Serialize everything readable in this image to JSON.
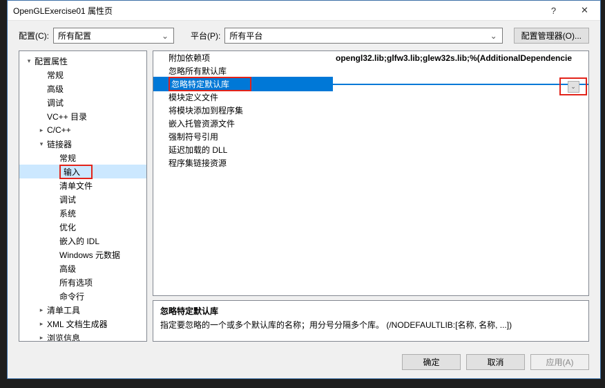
{
  "title": "OpenGLExercise01 属性页",
  "topbar": {
    "config_label": "配置(C):",
    "config_value": "所有配置",
    "platform_label": "平台(P):",
    "platform_value": "所有平台",
    "manager_btn": "配置管理器(O)..."
  },
  "tree": [
    {
      "label": "配置属性",
      "depth": 0,
      "arrow": "▾"
    },
    {
      "label": "常规",
      "depth": 1,
      "arrow": ""
    },
    {
      "label": "高级",
      "depth": 1,
      "arrow": ""
    },
    {
      "label": "调试",
      "depth": 1,
      "arrow": ""
    },
    {
      "label": "VC++ 目录",
      "depth": 1,
      "arrow": ""
    },
    {
      "label": "C/C++",
      "depth": 1,
      "arrow": "▸"
    },
    {
      "label": "链接器",
      "depth": 1,
      "arrow": "▾"
    },
    {
      "label": "常规",
      "depth": 2,
      "arrow": ""
    },
    {
      "label": "输入",
      "depth": 2,
      "arrow": "",
      "selected": true,
      "highlight": true
    },
    {
      "label": "清单文件",
      "depth": 2,
      "arrow": ""
    },
    {
      "label": "调试",
      "depth": 2,
      "arrow": ""
    },
    {
      "label": "系统",
      "depth": 2,
      "arrow": ""
    },
    {
      "label": "优化",
      "depth": 2,
      "arrow": ""
    },
    {
      "label": "嵌入的 IDL",
      "depth": 2,
      "arrow": ""
    },
    {
      "label": "Windows 元数据",
      "depth": 2,
      "arrow": ""
    },
    {
      "label": "高级",
      "depth": 2,
      "arrow": ""
    },
    {
      "label": "所有选项",
      "depth": 2,
      "arrow": ""
    },
    {
      "label": "命令行",
      "depth": 2,
      "arrow": ""
    },
    {
      "label": "清单工具",
      "depth": 1,
      "arrow": "▸"
    },
    {
      "label": "XML 文档生成器",
      "depth": 1,
      "arrow": "▸"
    },
    {
      "label": "浏览信息",
      "depth": 1,
      "arrow": "▸"
    }
  ],
  "props": [
    {
      "name": "附加依赖项",
      "value": "opengl32.lib;glfw3.lib;glew32s.lib;%(AdditionalDependencie",
      "bold_value": true
    },
    {
      "name": "忽略所有默认库",
      "value": ""
    },
    {
      "name": "忽略特定默认库",
      "value": "",
      "selected": true,
      "highlight_name": true
    },
    {
      "name": "模块定义文件",
      "value": ""
    },
    {
      "name": "将模块添加到程序集",
      "value": ""
    },
    {
      "name": "嵌入托管资源文件",
      "value": ""
    },
    {
      "name": "强制符号引用",
      "value": ""
    },
    {
      "name": "延迟加载的 DLL",
      "value": ""
    },
    {
      "name": "程序集链接资源",
      "value": ""
    }
  ],
  "desc": {
    "title": "忽略特定默认库",
    "body": "指定要忽略的一个或多个默认库的名称；用分号分隔多个库。     (/NODEFAULTLIB:[名称, 名称, ...])"
  },
  "footer": {
    "ok": "确定",
    "cancel": "取消",
    "apply": "应用(A)"
  },
  "icons": {
    "help": "?",
    "close": "✕",
    "dropdown": "⌄"
  }
}
